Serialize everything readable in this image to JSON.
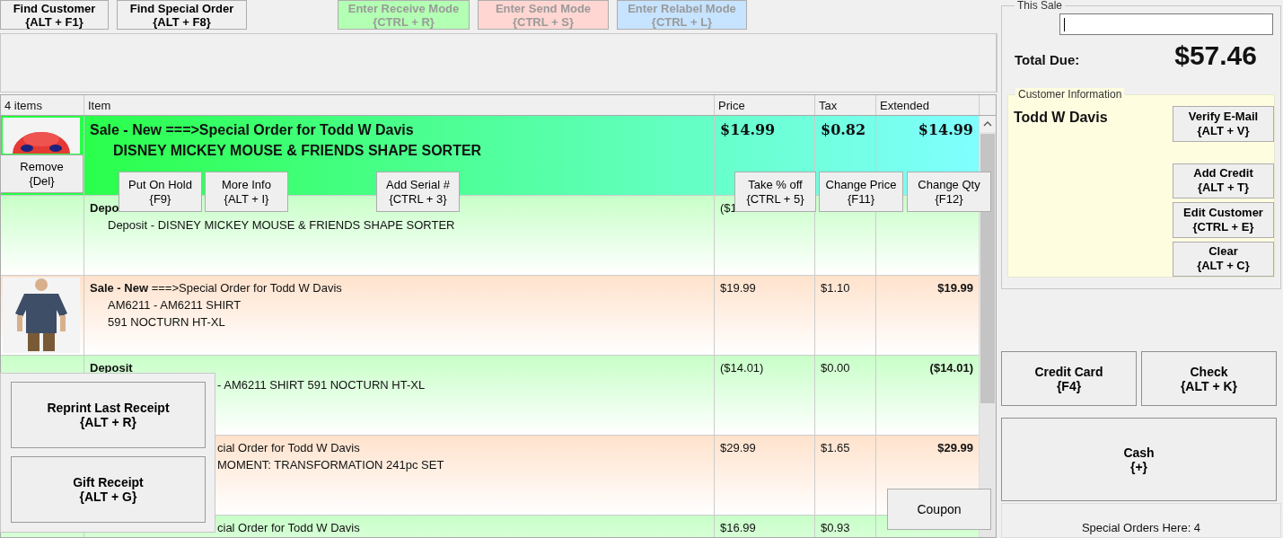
{
  "toolbar": [
    {
      "label": "Find Customer",
      "shortcut": "{ALT + F1}",
      "disabled": false,
      "color": "#f0f0f0"
    },
    {
      "label": "Find Special Order",
      "shortcut": "{ALT + F8}",
      "disabled": false,
      "color": "#f0f0f0"
    },
    {
      "label": "Enter Receive Mode",
      "shortcut": "{CTRL + R}",
      "disabled": true,
      "color": "#b3ffb3"
    },
    {
      "label": "Enter Send Mode",
      "shortcut": "{CTRL + S}",
      "disabled": true,
      "color": "#ffd6d2"
    },
    {
      "label": "Enter Relabel Mode",
      "shortcut": "{CTRL + L}",
      "disabled": true,
      "color": "#c6e3ff"
    }
  ],
  "table": {
    "count": "4 items",
    "columns": [
      "Item",
      "Price",
      "Tax",
      "Extended"
    ],
    "rows": [
      {
        "selected": true,
        "thumbnail": {
          "kind": "picture"
        },
        "lines": [
          {
            "kind": "heading",
            "text": "Sale - New ===>Special Order for Todd W Davis"
          },
          {
            "kind": "detail",
            "text": "DISNEY MICKEY MOUSE & FRIENDS SHAPE SORTER"
          }
        ],
        "price": "$14.99",
        "tax": "$0.82",
        "extended": "$14.99"
      },
      {
        "selected": false,
        "color": "#c8ffc8",
        "lines": [
          {
            "kind": "heading",
            "text": "Depo"
          },
          {
            "kind": "detail",
            "text": "Deposit - DISNEY MICKEY MOUSE & FRIENDS SHAPE SORTER"
          }
        ],
        "price": "($1"
      },
      {
        "selected": false,
        "color": "#ffe2cc",
        "thumbnail": {
          "kind": "picture"
        },
        "lines": [
          {
            "kind": "title",
            "text": "**Sale - New** ===>Special Order for Todd W Davis"
          },
          {
            "kind": "detail",
            "text": "AM6211 - AM6211 SHIRT"
          },
          {
            "kind": "detail",
            "text": "591 NOCTURN HT-XL"
          }
        ],
        "price": "$19.99",
        "tax": "$1.10",
        "extended": "$19.99"
      },
      {
        "selected": false,
        "color": "#c8ffc8",
        "lines": [
          {
            "kind": "heading",
            "text": "Deposit"
          },
          {
            "kind": "detail",
            "text": "- AM6211 SHIRT 591 NOCTURN HT-XL",
            "covered": true
          }
        ],
        "price": "($14.01)",
        "tax": "$0.00",
        "extended": "($14.01)"
      },
      {
        "selected": false,
        "color": "#ffe2cc",
        "lines": [
          {
            "kind": "title",
            "text": "cial Order for Todd W Davis",
            "covered": true
          },
          {
            "kind": "detail",
            "text": "MOMENT: TRANSFORMATION 241pc SET",
            "covered": true
          }
        ],
        "price": "$29.99",
        "tax": "$1.65",
        "extended": "$29.99"
      },
      {
        "selected": false,
        "color": "#c8ffc8",
        "lines": [
          {
            "kind": "title",
            "text": "cial Order for Todd W Davis",
            "covered": true
          }
        ],
        "price": "$16.99",
        "tax": "$0.93"
      }
    ]
  },
  "row_actions": [
    {
      "label": "Remove",
      "shortcut": "{Del}"
    },
    {
      "label": "Put On Hold",
      "shortcut": "{F9}"
    },
    {
      "label": "More Info",
      "shortcut": "{ALT + I}"
    },
    {
      "label": "Add Serial #",
      "shortcut": "{CTRL + 3}"
    },
    {
      "label": "Take % off",
      "shortcut": "{CTRL + 5}"
    },
    {
      "label": "Change Price",
      "shortcut": "{F11}"
    },
    {
      "label": "Change Qty",
      "shortcut": "{F12}"
    }
  ],
  "receipt_menu": [
    {
      "label": "Reprint Last Receipt",
      "shortcut": "{ALT + R}"
    },
    {
      "label": "Gift Receipt",
      "shortcut": "{ALT + G}"
    }
  ],
  "coupon_button": {
    "label": "Coupon"
  },
  "this_sale": {
    "title": "This Sale",
    "total_label": "Total Due:",
    "total": "$57.46"
  },
  "customer": {
    "title": "Customer Information",
    "name": "Todd W Davis",
    "actions": [
      {
        "label": "Verify E-Mail",
        "shortcut": "{ALT + V}"
      },
      {
        "label": "Add Credit",
        "shortcut": "{ALT + T}"
      },
      {
        "label": "Edit Customer",
        "shortcut": "{CTRL + E}"
      },
      {
        "label": "Clear",
        "shortcut": "{ALT + C}"
      }
    ]
  },
  "payments": [
    {
      "label": "Credit Card",
      "shortcut": "{F4}"
    },
    {
      "label": "Check",
      "shortcut": "{ALT + K}"
    },
    {
      "label": "Cash",
      "shortcut": "{+}"
    }
  ],
  "status": "Special Orders Here: 4"
}
